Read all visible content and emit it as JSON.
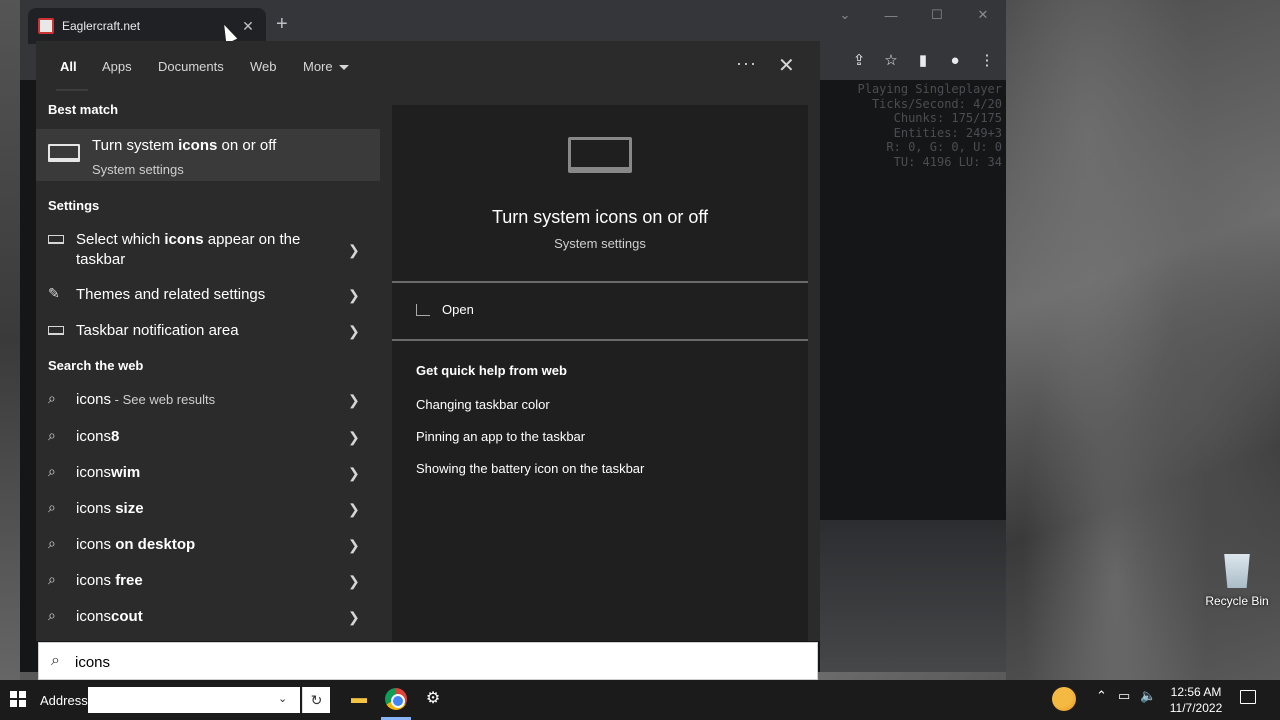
{
  "browser": {
    "tab_title": "Eaglercraft.net",
    "new_tab_symbol": "+",
    "debug_lines": [
      "Playing Singleplayer",
      "Ticks/Second: 4/20",
      "Chunks: 175/175",
      "Entities: 249+3",
      "R: 0, G: 0, U: 0",
      "TU: 4196 LU: 34"
    ]
  },
  "search": {
    "filters": [
      "All",
      "Apps",
      "Documents",
      "Web",
      "More"
    ],
    "ellipsis": "···",
    "close_symbol": "✕",
    "best_match_heading": "Best match",
    "best_match": {
      "title_prefix": "Turn system ",
      "title_bold": "icons",
      "title_suffix": " on or off",
      "subtitle": "System settings"
    },
    "settings_heading": "Settings",
    "settings": [
      {
        "prefix": "Select which ",
        "bold": "icons",
        "suffix": " appear on the taskbar"
      },
      {
        "prefix": "Themes and related settings",
        "bold": "",
        "suffix": ""
      },
      {
        "prefix": "Taskbar notification area",
        "bold": "",
        "suffix": ""
      }
    ],
    "web_heading": "Search the web",
    "web_results": [
      {
        "query": "icons",
        "bold": "",
        "sub": " - See web results"
      },
      {
        "query": "icons",
        "bold": "8",
        "sub": ""
      },
      {
        "query": "icons",
        "bold": "wim",
        "sub": ""
      },
      {
        "query": "icons ",
        "bold": "size",
        "sub": ""
      },
      {
        "query": "icons ",
        "bold": "on desktop",
        "sub": ""
      },
      {
        "query": "icons ",
        "bold": "free",
        "sub": ""
      },
      {
        "query": "icons",
        "bold": "cout",
        "sub": ""
      }
    ],
    "preview": {
      "title": "Turn system icons on or off",
      "subtitle": "System settings",
      "open_label": "Open",
      "help_heading": "Get quick help from web",
      "links": [
        "Changing taskbar color",
        "Pinning an app to the taskbar",
        "Showing the battery icon on the taskbar"
      ]
    },
    "query": "icons"
  },
  "taskbar": {
    "address_label": "Address",
    "address_value": "",
    "time": "12:56 AM",
    "date": "11/7/2022"
  },
  "desktop": {
    "recycle_bin_label": "Recycle Bin"
  }
}
